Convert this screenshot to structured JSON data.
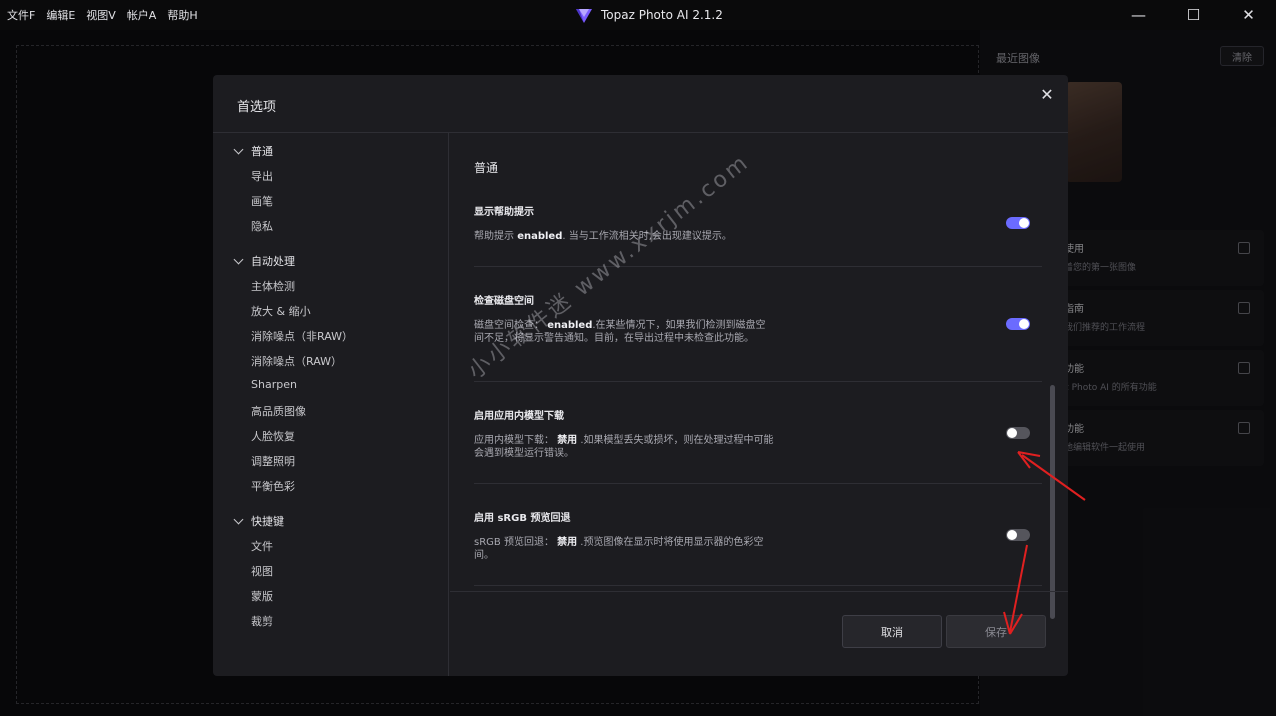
{
  "menubar": {
    "items": [
      "文件F",
      "编辑E",
      "视图V",
      "帐户A",
      "帮助H"
    ]
  },
  "app": {
    "title": "Topaz Photo AI 2.1.2"
  },
  "window_controls": {
    "minimize": "—",
    "maximize": "☐",
    "close": "✕"
  },
  "right_panel": {
    "recent_title": "最近图像",
    "clear_label": "清除",
    "cards": [
      {
        "title": "使用",
        "subtitle": "着您的第一张图像"
      },
      {
        "title": "指南",
        "subtitle": "我们推荐的工作流程"
      },
      {
        "title": "功能",
        "subtitle": "z Photo AI 的所有功能"
      },
      {
        "title": "功能",
        "subtitle": "他编辑软件一起使用"
      }
    ]
  },
  "dialog": {
    "title": "首选项",
    "close_icon": "✕",
    "sidebar": {
      "sections": [
        {
          "label": "普通",
          "items": [
            "导出",
            "画笔",
            "隐私"
          ]
        },
        {
          "label": "自动处理",
          "items": [
            "主体检测",
            "放大 & 缩小",
            "消除噪点（非RAW）",
            "消除噪点（RAW）",
            "Sharpen",
            "高品质图像",
            "人脸恢复",
            "调整照明",
            "平衡色彩"
          ]
        },
        {
          "label": "快捷键",
          "items": [
            "文件",
            "视图",
            "蒙版",
            "裁剪"
          ]
        }
      ]
    },
    "content": {
      "title": "普通",
      "settings": [
        {
          "title": "显示帮助提示",
          "desc_prefix": "帮助提示 ",
          "desc_value": "enabled",
          "desc_suffix": ". 当与工作流相关时,会出现建议提示。",
          "enabled": true
        },
        {
          "title": "检查磁盘空间",
          "desc_prefix": "磁盘空间检查： ",
          "desc_value": "enabled",
          "desc_suffix": ".在某些情况下，如果我们检测到磁盘空间不足，将显示警告通知。目前，在导出过程中未检查此功能。",
          "enabled": true
        },
        {
          "title": "启用应用内模型下载",
          "desc_prefix": "应用内模型下载： ",
          "desc_value": "禁用",
          "desc_suffix": " .如果模型丢失或损坏，则在处理过程中可能会遇到模型运行错误。",
          "enabled": false
        },
        {
          "title": "启用 sRGB 预览回退",
          "desc_prefix": "sRGB 预览回退： ",
          "desc_value": "禁用",
          "desc_suffix": " .预览图像在显示时将使用显示器的色彩空间。",
          "enabled": false
        }
      ],
      "cancel_label": "取消",
      "save_label": "保存"
    }
  },
  "watermark": "小小软件迷 www.xxrjm.com",
  "colors": {
    "toggle_on": "#6b6bff",
    "toggle_off": "#55555c",
    "arrow": "#e02020"
  }
}
